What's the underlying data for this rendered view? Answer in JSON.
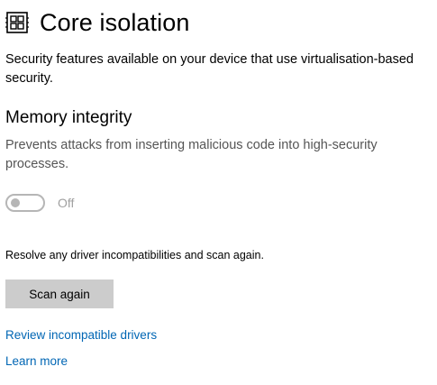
{
  "header": {
    "icon": "core-isolation-chip-icon",
    "title": "Core isolation"
  },
  "description": "Security features available on your device that use virtualisation-based security.",
  "memory_integrity": {
    "heading": "Memory integrity",
    "description": "Prevents attacks from inserting malicious code into high-security processes.",
    "toggle_state": "Off",
    "toggle_enabled": false
  },
  "resolve": {
    "text": "Resolve any driver incompatibilities and scan again.",
    "scan_button": "Scan again"
  },
  "links": {
    "review_drivers": "Review incompatible drivers",
    "learn_more": "Learn more"
  },
  "colors": {
    "link": "#0066b4",
    "button_bg": "#cccccc",
    "toggle_disabled": "#b6b6b6",
    "muted_text": "#555555"
  }
}
